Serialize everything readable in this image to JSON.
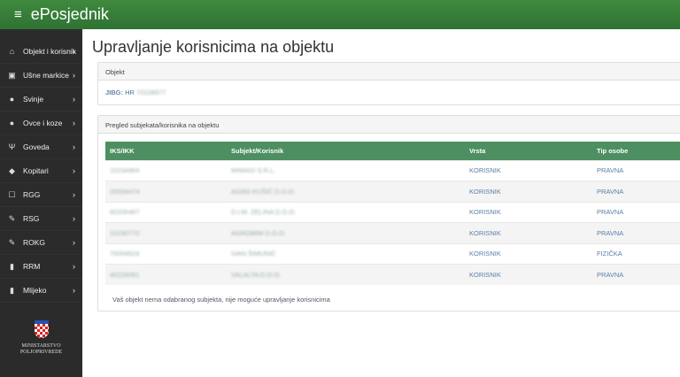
{
  "header": {
    "title": "ePosjednik",
    "menu_icon": "hamburger-icon"
  },
  "sidebar": {
    "items": [
      {
        "label": "Objekt i korisnik",
        "icon": "home-lock-icon"
      },
      {
        "label": "Ušne markice",
        "icon": "tag-icon"
      },
      {
        "label": "Svinje",
        "icon": "pig-icon"
      },
      {
        "label": "Ovce i koze",
        "icon": "sheep-icon"
      },
      {
        "label": "Goveda",
        "icon": "cow-icon"
      },
      {
        "label": "Kopitari",
        "icon": "horse-icon"
      },
      {
        "label": "RGG",
        "icon": "edit-icon"
      },
      {
        "label": "RSG",
        "icon": "document-edit-icon"
      },
      {
        "label": "ROKG",
        "icon": "document-edit-icon"
      },
      {
        "label": "RRM",
        "icon": "bottle-icon"
      },
      {
        "label": "Mlijeko",
        "icon": "milk-icon"
      }
    ],
    "logo": {
      "line1": "MINISTARSTVO",
      "line2": "POLJOPRIVREDE"
    }
  },
  "page": {
    "title": "Upravljanje korisnicima na objektu"
  },
  "object_panel": {
    "heading": "Objekt",
    "jibg_label": "JIBG:",
    "jibg_value": "HR 70108977"
  },
  "users_panel": {
    "heading": "Pregled subjekata/korisnika na objektu",
    "columns": [
      "IKS/IKK",
      "Subjekt/Korisnik",
      "Vrsta",
      "Tip osobe"
    ],
    "rows": [
      [
        "10234964",
        "MIMAGI S.R.L.",
        "KORISNIK",
        "PRAVNA"
      ],
      [
        "20034474",
        "AGRO KUŠIĆ D.O.O.",
        "KORISNIK",
        "PRAVNA"
      ],
      [
        "60205467",
        "D.I.M. ZELINA D.O.O.",
        "KORISNIK",
        "PRAVNA"
      ],
      [
        "10230770",
        "AGROMIM D.O.O.",
        "KORISNIK",
        "PRAVNA"
      ],
      [
        "70004624",
        "IVAN ŠIMUNIĆ",
        "KORISNIK",
        "FIZIČKA"
      ],
      [
        "40226091",
        "VALALTA D.O.O.",
        "KORISNIK",
        "PRAVNA"
      ]
    ],
    "note": "Vaš objekt nema odabranog subjekta, nije moguće upravljanje korisnicima"
  }
}
